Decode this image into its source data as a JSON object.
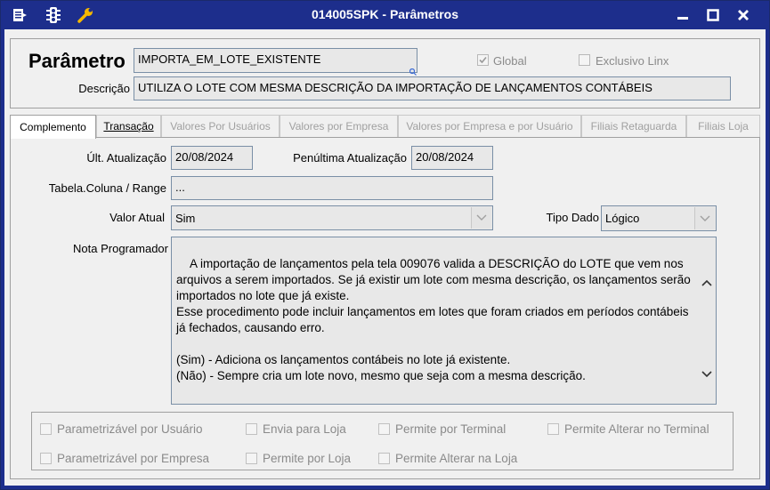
{
  "window": {
    "title": "014005SPK - Parâmetros"
  },
  "header": {
    "param_heading": "Parâmetro",
    "param_value": "IMPORTA_EM_LOTE_EXISTENTE",
    "global_label": "Global",
    "global_checked": true,
    "exclusivo_label": "Exclusivo Linx",
    "exclusivo_checked": false,
    "descricao_label": "Descrição",
    "descricao_value": "UTILIZA O LOTE COM MESMA DESCRIÇÃO DA IMPORTAÇÃO DE LANÇAMENTOS CONTÁBEIS"
  },
  "tabs": [
    {
      "label": "Complemento",
      "state": "active"
    },
    {
      "label": "Transação",
      "state": "normal"
    },
    {
      "label": "Valores Por Usuários",
      "state": "disabled"
    },
    {
      "label": "Valores por Empresa",
      "state": "disabled"
    },
    {
      "label": "Valores por Empresa e por Usuário",
      "state": "disabled"
    },
    {
      "label": "Filiais Retaguarda",
      "state": "disabled"
    },
    {
      "label": "Filiais Loja",
      "state": "disabled"
    }
  ],
  "complemento": {
    "ult_atualizacao_label": "Últ. Atualização",
    "ult_atualizacao_value": "20/08/2024",
    "penultima_label": "Penúltima Atualização",
    "penultima_value": "20/08/2024",
    "tabela_coluna_label": "Tabela.Coluna / Range",
    "tabela_coluna_value": "...",
    "valor_atual_label": "Valor Atual",
    "valor_atual_value": "Sim",
    "tipo_dado_label": "Tipo Dado",
    "tipo_dado_value": "Lógico",
    "nota_label": "Nota Programador",
    "nota_value": "A importação de lançamentos pela tela 009076 valida a DESCRIÇÃO do LOTE que vem nos arquivos a serem importados. Se já existir um lote com mesma descrição, os lançamentos serão importados no lote que já existe.\nEsse procedimento pode incluir lançamentos em lotes que foram criados em períodos contábeis já fechados, causando erro.\n\n(Sim) - Adiciona os lançamentos contábeis no lote já existente.\n(Não) - Sempre cria um lote novo, mesmo que seja com a mesma descrição."
  },
  "flags": {
    "param_usuario": "Parametrizável por Usuário",
    "envia_loja": "Envia para Loja",
    "permite_terminal": "Permite por Terminal",
    "permite_alterar_terminal": "Permite Alterar no Terminal",
    "param_empresa": "Parametrizável por Empresa",
    "permite_loja": "Permite por Loja",
    "permite_alterar_loja": "Permite Alterar na Loja"
  },
  "colors": {
    "titlebar": "#1d2e8c",
    "field_bg": "#e8e8e8",
    "disabled_text": "#8a8a8a"
  },
  "icons": [
    "menu-icon",
    "traffic-light-icon",
    "wrench-icon",
    "minimize-icon",
    "maximize-icon",
    "close-icon",
    "resize-grip-icon",
    "dropdown-arrow-icon",
    "scroll-up-icon",
    "scroll-down-icon"
  ]
}
